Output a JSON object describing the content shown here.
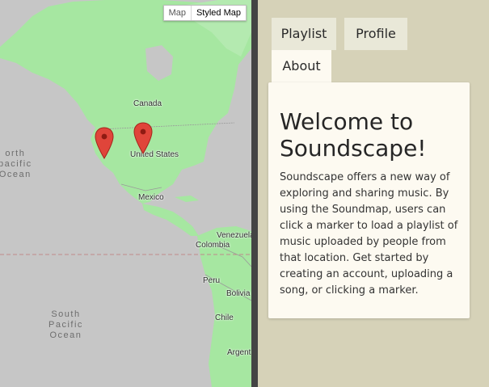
{
  "map": {
    "type_control": {
      "map_label": "Map",
      "styled_label": "Styled Map"
    },
    "labels": {
      "canada": "Canada",
      "united_states": "United States",
      "mexico": "Mexico",
      "venezuela": "Venezuela",
      "colombia": "Colombia",
      "peru": "Peru",
      "bolivia": "Bolivia",
      "chile": "Chile",
      "argentina": "Argent"
    },
    "ocean_labels": {
      "north_pacific": "orth\npacific\nOcean",
      "south_pacific": "South\nPacific\nOcean"
    },
    "markers": [
      {
        "name": "marker-west-coast",
        "color": "#e0453a"
      },
      {
        "name": "marker-mountain",
        "color": "#e0453a"
      }
    ]
  },
  "panel": {
    "tabs": [
      {
        "label": "Playlist"
      },
      {
        "label": "Profile"
      },
      {
        "label": "About",
        "active": true
      }
    ],
    "about": {
      "title": "Welcome to Soundscape!",
      "body": "Soundscape offers a new way of exploring and sharing music. By using the Soundmap, users can click a marker to load a playlist of music uploaded by people from that location. Get started by creating an account, uploading a song, or clicking a marker."
    }
  },
  "colors": {
    "ocean": "#c6c6c6",
    "land": "#a6e7a1",
    "panel_bg": "#d6d2b8",
    "card_bg": "#fdfaf1",
    "tab_bg": "#e9e8d8",
    "marker": "#e0453a"
  }
}
